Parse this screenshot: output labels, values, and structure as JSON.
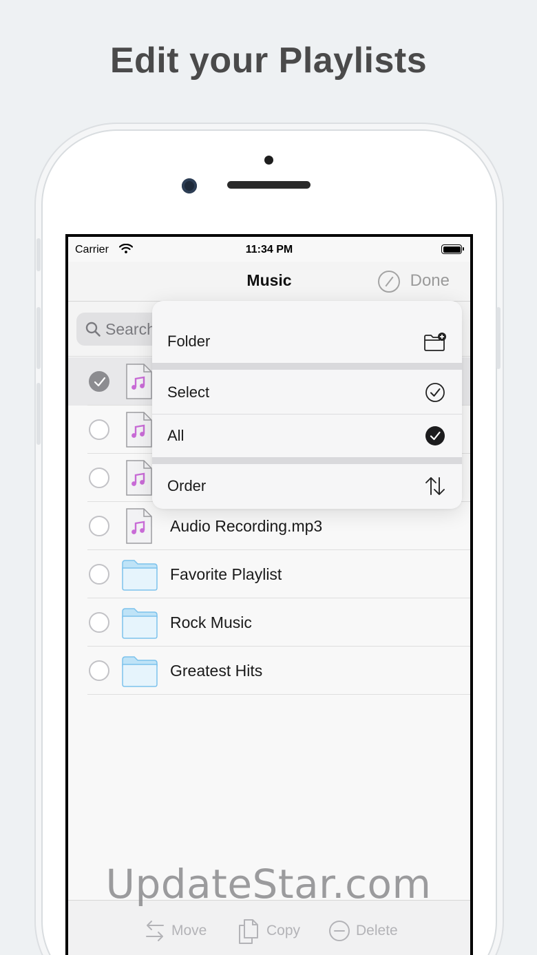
{
  "headline": "Edit your Playlists",
  "status": {
    "carrier": "Carrier",
    "time": "11:34 PM"
  },
  "nav": {
    "title": "Music",
    "done_label": "Done"
  },
  "search": {
    "placeholder": "Search"
  },
  "files": [
    {
      "name": "",
      "type": "audio",
      "selected": true
    },
    {
      "name": "",
      "type": "audio",
      "selected": false
    },
    {
      "name": "",
      "type": "audio",
      "selected": false
    },
    {
      "name": "Audio Recording.mp3",
      "type": "audio",
      "selected": false
    },
    {
      "name": "Favorite Playlist",
      "type": "folder",
      "selected": false
    },
    {
      "name": "Rock Music",
      "type": "folder",
      "selected": false
    },
    {
      "name": "Greatest Hits",
      "type": "folder",
      "selected": false
    }
  ],
  "menu": {
    "folder": {
      "label": "Folder",
      "icon": "new-folder-icon"
    },
    "select": {
      "label": "Select",
      "icon": "check-circle-icon"
    },
    "all": {
      "label": "All",
      "icon": "filled-check-circle-icon"
    },
    "order": {
      "label": "Order",
      "icon": "sort-arrows-icon"
    }
  },
  "toolbar": {
    "move": "Move",
    "copy": "Copy",
    "delete": "Delete"
  },
  "watermark": "UpdateStar.com",
  "colors": {
    "background": "#eef1f3",
    "disabled": "#b3b3b7",
    "music_note": "#c86bd6",
    "folder_blue": "#7cc2ec"
  }
}
